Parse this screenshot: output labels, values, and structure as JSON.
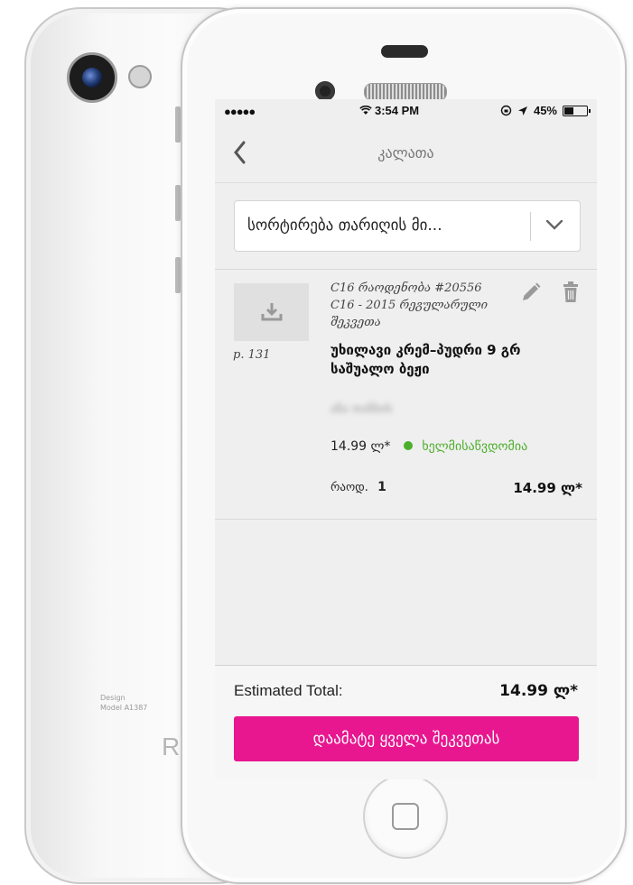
{
  "back_phone": {
    "model_text_line1": "Design",
    "model_text_line2": "Model A1387",
    "logo_text": "R"
  },
  "status_bar": {
    "signal": "●●●●●",
    "time": "3:54 PM",
    "battery": "45%",
    "battery_level": 0.45
  },
  "nav": {
    "back_icon": "chevron-left-icon",
    "title": "კალათა"
  },
  "sort": {
    "label": "სორტირება თარიღის მი...",
    "icon": "chevron-down-icon"
  },
  "item": {
    "thumbnail_icon": "download-icon",
    "page_ref": "p. 131",
    "order_line1": "C16 რაოდენობა #20556",
    "order_line2": "C16 - 2015 რეგულარული შეკვეთა",
    "name": "უხილავი კრემ–პუდრი 9 გრ საშუალო ბეჟი",
    "blurred_text": "ანა თანხის",
    "unit_price": "14.99 ლ*",
    "availability": "ხელმისაწვდომია",
    "qty_label": "რაოდ.",
    "qty_value": "1",
    "line_total": "14.99 ლ*",
    "edit_icon": "pencil-icon",
    "delete_icon": "trash-icon"
  },
  "totals": {
    "label": "Estimated Total:",
    "value": "14.99 ლ*",
    "button_label": "დაამატე ყველა შეკვეთას"
  },
  "colors": {
    "accent": "#e8168f",
    "available": "#4caf2b"
  }
}
